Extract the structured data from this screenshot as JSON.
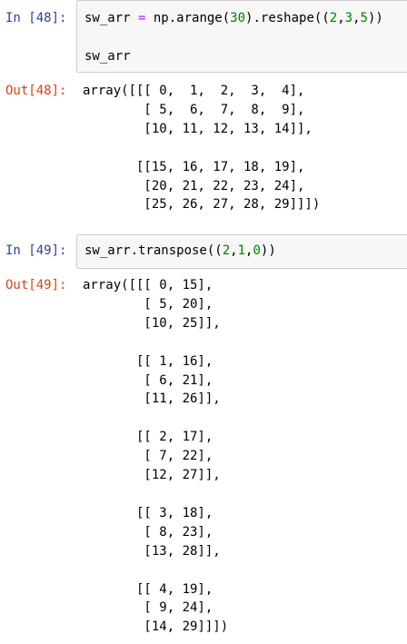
{
  "cells": [
    {
      "in_prompt": "In [48]:",
      "code_line_1": {
        "t1": "sw_arr ",
        "t2": "=",
        "t3": " np.arange(",
        "t4": "30",
        "t5": ").reshape((",
        "t6": "2",
        "t7": ",",
        "t8": "3",
        "t9": ",",
        "t10": "5",
        "t11": "))"
      },
      "code_line_2": "sw_arr",
      "out_prompt": "Out[48]:",
      "output": "array([[[ 0,  1,  2,  3,  4],\n        [ 5,  6,  7,  8,  9],\n        [10, 11, 12, 13, 14]],\n\n       [[15, 16, 17, 18, 19],\n        [20, 21, 22, 23, 24],\n        [25, 26, 27, 28, 29]]])"
    },
    {
      "in_prompt": "In [49]:",
      "code_line_1": {
        "t1": "sw_arr.transpose((",
        "t2": "2",
        "t3": ",",
        "t4": "1",
        "t5": ",",
        "t6": "0",
        "t7": "))"
      },
      "out_prompt": "Out[49]:",
      "output": "array([[[ 0, 15],\n        [ 5, 20],\n        [10, 25]],\n\n       [[ 1, 16],\n        [ 6, 21],\n        [11, 26]],\n\n       [[ 2, 17],\n        [ 7, 22],\n        [12, 27]],\n\n       [[ 3, 18],\n        [ 8, 23],\n        [13, 28]],\n\n       [[ 4, 19],\n        [ 9, 24],\n        [14, 29]]])"
    }
  ],
  "colors": {
    "in_prompt": "#303f9f",
    "out_prompt": "#d84315",
    "number": "#008000",
    "operator": "#aa22ff",
    "input_background": "#f7f7f7",
    "input_border": "#cfcfcf"
  }
}
